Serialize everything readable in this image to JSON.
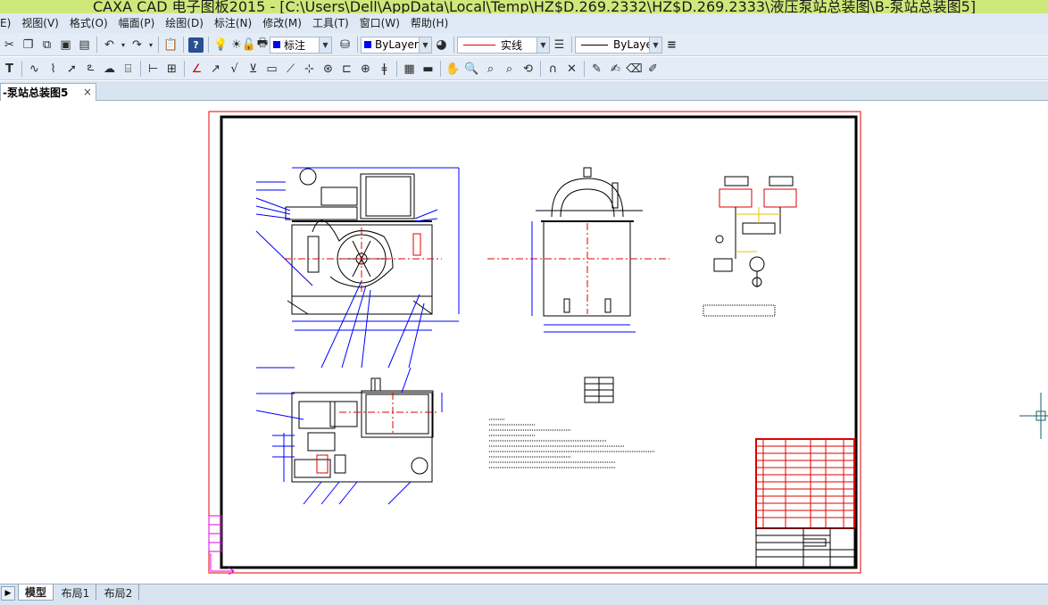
{
  "window": {
    "title": "CAXA CAD 电子图板2015 - [C:\\Users\\Dell\\AppData\\Local\\Temp\\HZ$D.269.2332\\HZ$D.269.2333\\液压泵站总装图\\B-泵站总装图5]"
  },
  "menu": {
    "items": [
      "E)",
      "视图(V)",
      "格式(O)",
      "幅面(P)",
      "绘图(D)",
      "标注(N)",
      "修改(M)",
      "工具(T)",
      "窗口(W)",
      "帮助(H)"
    ]
  },
  "toolbar1": {
    "layer_value": "标注",
    "color_value": "ByLayer",
    "linetype_value": "实线",
    "linewidth_value": "ByLayer",
    "accent_color": "#0000ff",
    "linetype_color": "#e00000"
  },
  "tabs": {
    "document_tab": "-泵站总装图5",
    "close_symbol": "×"
  },
  "layout_tabs": [
    "模型",
    "布局1",
    "布局2"
  ],
  "colors": {
    "titlebar": "#cfe87a",
    "frame_red": "#e00000",
    "drawing_blue": "#0000ff",
    "toolbar_bg": "#e3ecf7"
  }
}
